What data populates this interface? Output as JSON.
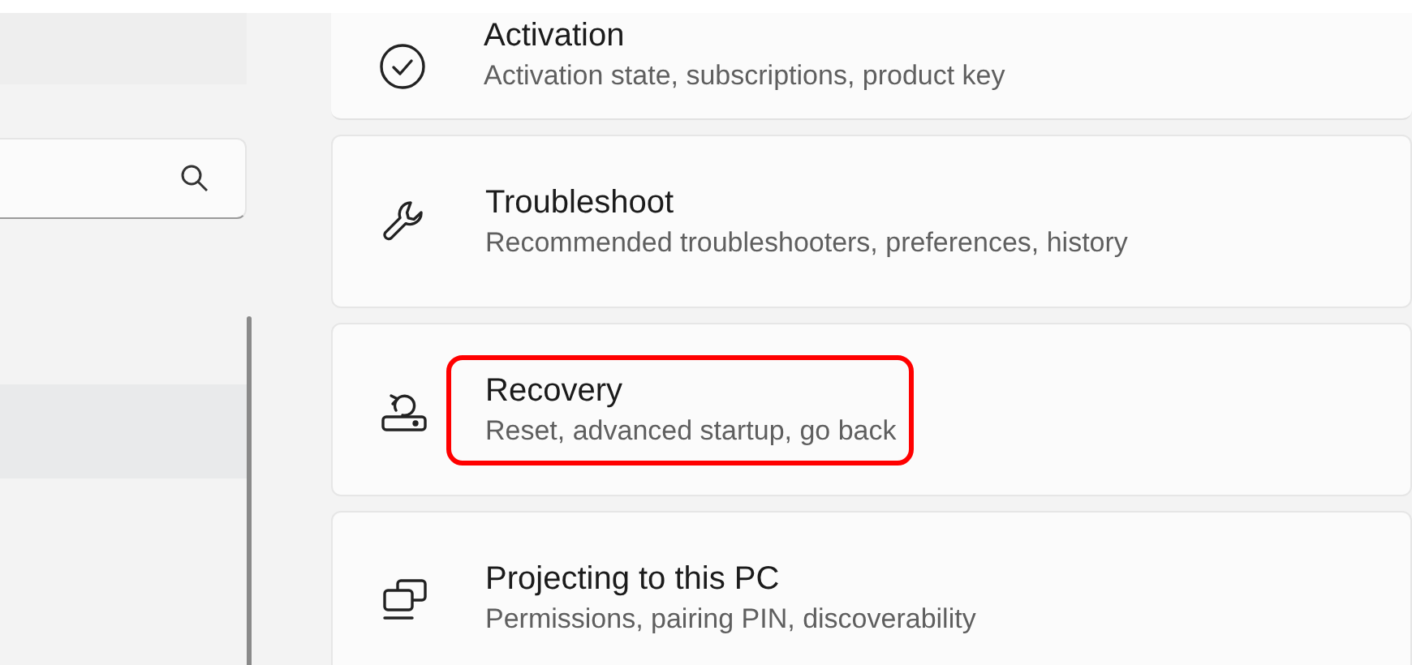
{
  "cards": [
    {
      "kind": "check",
      "title": "Activation",
      "subtitle": "Activation state, subscriptions, product key",
      "highlighted": false
    },
    {
      "kind": "wrench",
      "title": "Troubleshoot",
      "subtitle": "Recommended troubleshooters, preferences, history",
      "highlighted": false
    },
    {
      "kind": "recovery",
      "title": "Recovery",
      "subtitle": "Reset, advanced startup, go back",
      "highlighted": true
    },
    {
      "kind": "project",
      "title": "Projecting to this PC",
      "subtitle": "Permissions, pairing PIN, discoverability",
      "highlighted": false
    }
  ]
}
